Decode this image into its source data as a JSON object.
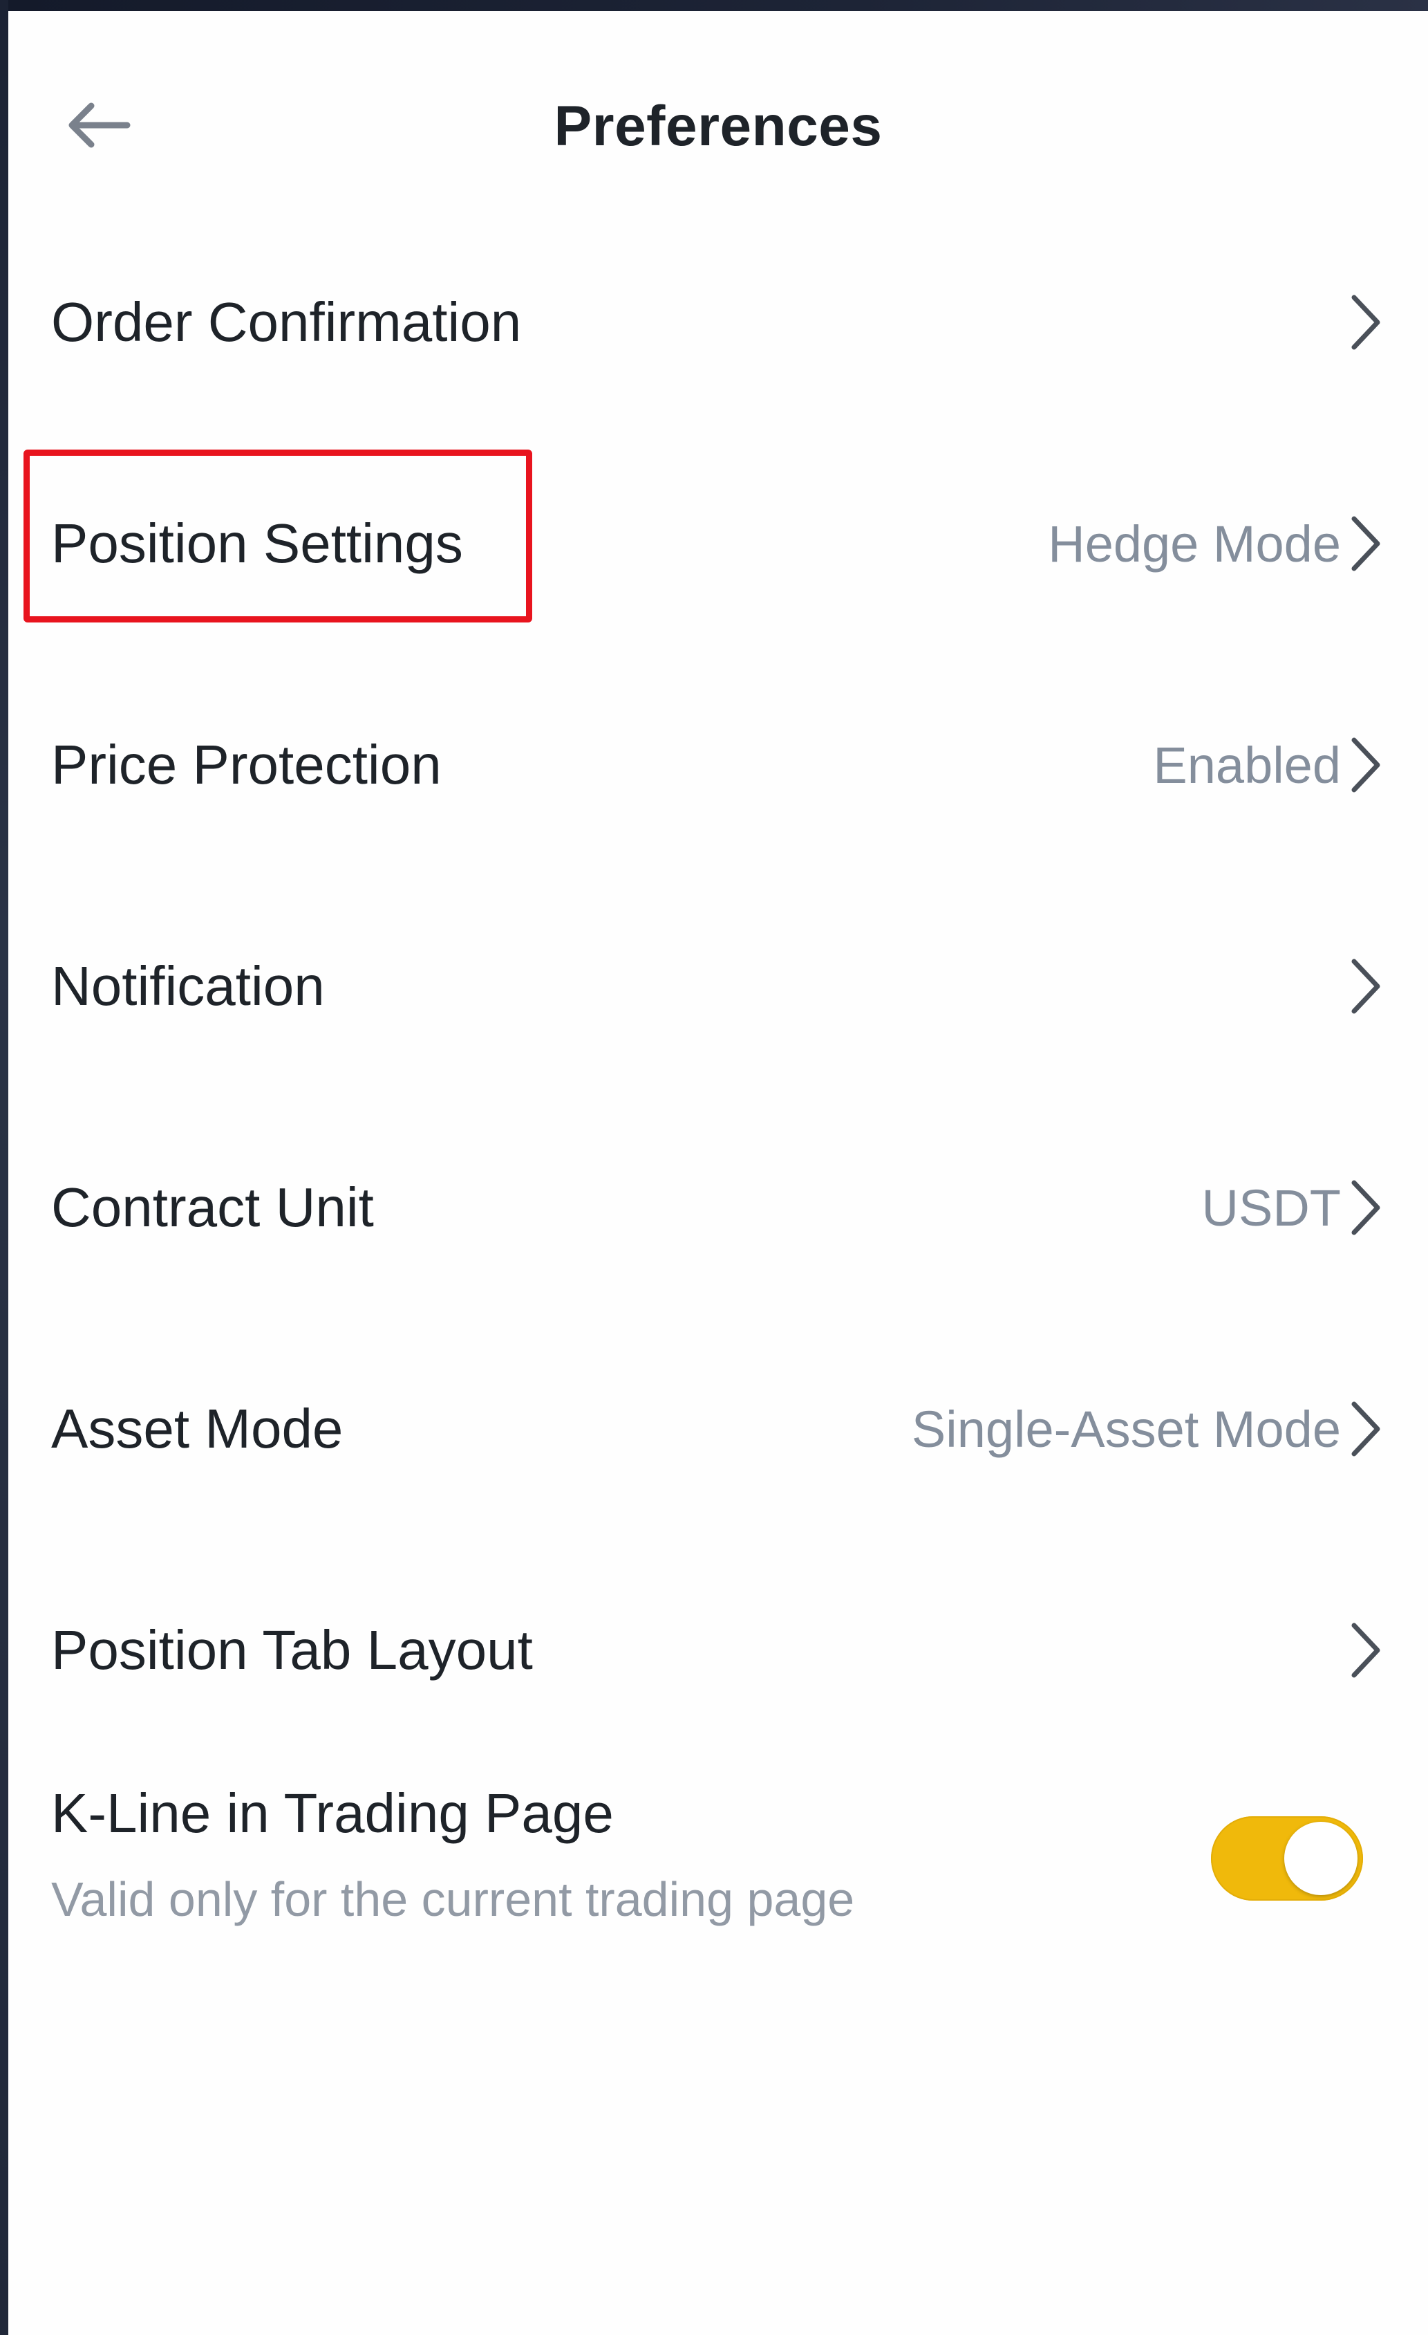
{
  "header": {
    "title": "Preferences",
    "back_icon": "arrow-left-icon"
  },
  "settings": [
    {
      "label": "Order Confirmation",
      "value": "",
      "icon": "chevron-right-icon"
    },
    {
      "label": "Position Settings",
      "value": "Hedge Mode",
      "icon": "chevron-right-icon"
    },
    {
      "label": "Price Protection",
      "value": "Enabled",
      "icon": "chevron-right-icon"
    },
    {
      "label": "Notification",
      "value": "",
      "icon": "chevron-right-icon"
    },
    {
      "label": "Contract Unit",
      "value": "USDT",
      "icon": "chevron-right-icon"
    },
    {
      "label": "Asset Mode",
      "value": "Single-Asset Mode",
      "icon": "chevron-right-icon"
    },
    {
      "label": "Position Tab Layout",
      "value": "",
      "icon": "chevron-right-icon"
    }
  ],
  "kline": {
    "title": "K-Line in Trading Page",
    "subtitle": "Valid only for the current trading page",
    "enabled": true
  },
  "highlight": {
    "target": "Position Settings",
    "color": "#e8141e"
  },
  "colors": {
    "accent": "#f0b90b",
    "text_primary": "#1e2329",
    "text_secondary": "#848e9c"
  }
}
